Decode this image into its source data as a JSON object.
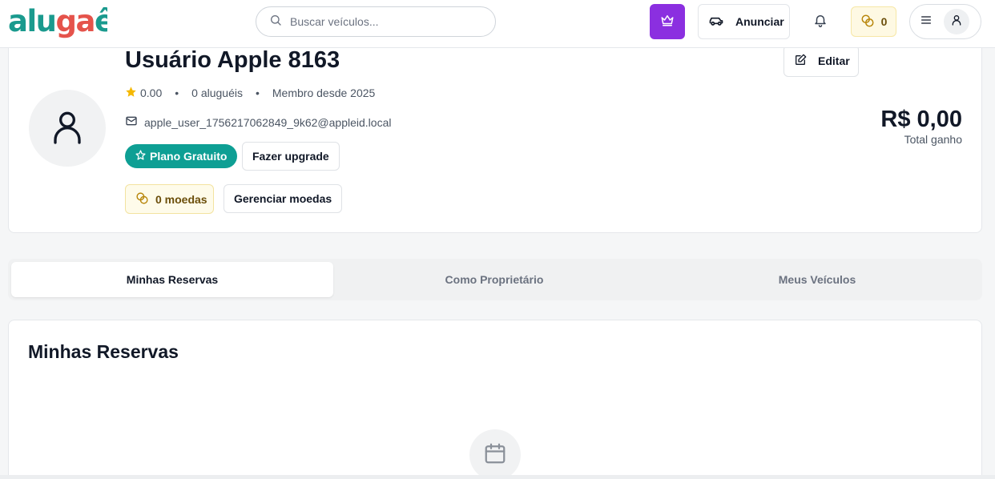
{
  "header": {
    "logo": {
      "text": "alugaê",
      "colors": {
        "prefix": "#1a9a8e",
        "suffix": "#e5534b"
      }
    },
    "search": {
      "placeholder": "Buscar veículos...",
      "value": ""
    },
    "premium_icon": "crown-icon",
    "anunciar_label": "Anunciar",
    "coins_count": "0",
    "notification_icon": "bell-icon",
    "menu_icon": "menu-icon",
    "avatar_icon": "user-icon"
  },
  "profile": {
    "name": "Usuário Apple 8163",
    "rating": "0.00",
    "rentals": "0 aluguéis",
    "member_since": "Membro desde 2025",
    "email": "apple_user_1756217062849_9k62@appleid.local",
    "plan_label": "Plano Gratuito",
    "upgrade_label": "Fazer upgrade",
    "coins_label": "0 moedas",
    "manage_coins_label": "Gerenciar moedas",
    "edit_label": "Editar",
    "earnings_value": "R$ 0,00",
    "earnings_label": "Total ganho"
  },
  "tabs": [
    {
      "label": "Minhas Reservas",
      "active": true
    },
    {
      "label": "Como Proprietário",
      "active": false
    },
    {
      "label": "Meus Veículos",
      "active": false
    }
  ],
  "reservations": {
    "title": "Minhas Reservas",
    "empty_icon": "calendar-icon"
  },
  "colors": {
    "accent_teal": "#0e9f94",
    "premium_purple": "#8b2fe0",
    "coins_bg": "#fef9e3",
    "star": "#f5b800"
  }
}
